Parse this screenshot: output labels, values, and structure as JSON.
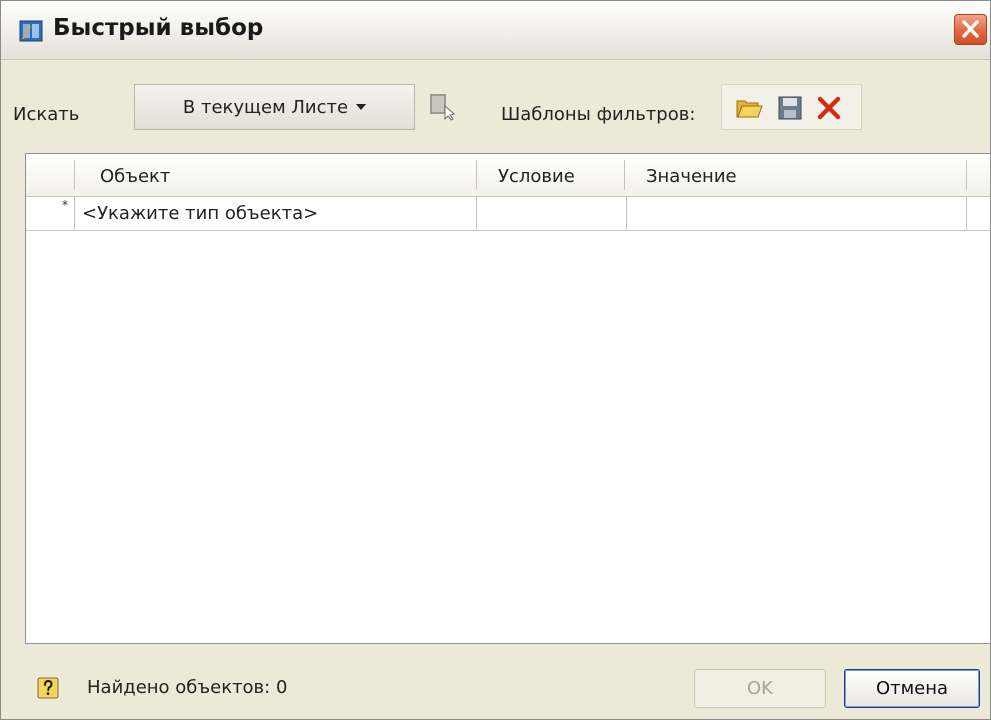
{
  "window": {
    "title": "Быстрый выбор"
  },
  "toolbar": {
    "search_label": "Искать",
    "scope_value": "В текущем Листе",
    "filter_templates_label": "Шаблоны фильтров:"
  },
  "grid": {
    "columns": [
      "Объект",
      "Условие",
      "Значение"
    ],
    "rows": [
      {
        "marker": "*",
        "object": "<Укажите тип объекта>",
        "condition": "",
        "value": ""
      }
    ]
  },
  "status": {
    "found_text": "Найдено объектов: 0"
  },
  "buttons": {
    "ok_label": "OK",
    "cancel_label": "Отмена"
  },
  "colors": {
    "dialog_bg": "#ece9d8",
    "close_button": "#e06a44",
    "delete_icon": "#d42a12",
    "folder_icon": "#f2c94c"
  },
  "icons": [
    "app-icon",
    "close-icon",
    "dropdown-caret-icon",
    "select-objects-icon",
    "open-folder-icon",
    "save-icon",
    "delete-icon",
    "help-icon"
  ]
}
